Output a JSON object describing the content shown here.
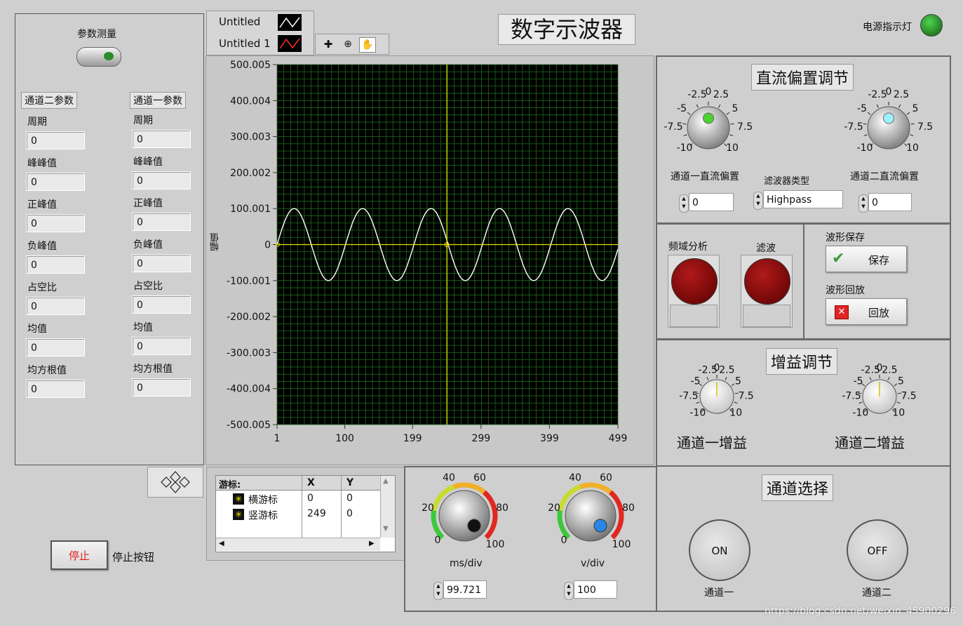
{
  "title": "数字示波器",
  "power": {
    "label": "电源指示灯",
    "color": "#1a7a1a"
  },
  "param_measure": {
    "label": "参数测量"
  },
  "channel2_params": {
    "header": "通道二参数",
    "items": [
      {
        "label": "周期",
        "value": "0"
      },
      {
        "label": "峰峰值",
        "value": "0"
      },
      {
        "label": "正峰值",
        "value": "0"
      },
      {
        "label": "负峰值",
        "value": "0"
      },
      {
        "label": "占空比",
        "value": "0"
      },
      {
        "label": "均值",
        "value": "0"
      },
      {
        "label": "均方根值",
        "value": "0"
      }
    ]
  },
  "channel1_params": {
    "header": "通道一参数",
    "items": [
      {
        "label": "周期",
        "value": "0"
      },
      {
        "label": "峰峰值",
        "value": "0"
      },
      {
        "label": "正峰值",
        "value": "0"
      },
      {
        "label": "负峰值",
        "value": "0"
      },
      {
        "label": "占空比",
        "value": "0"
      },
      {
        "label": "均值",
        "value": "0"
      },
      {
        "label": "均方根值",
        "value": "0"
      }
    ]
  },
  "legend": [
    {
      "name": "Untitled",
      "color": "#ffffff"
    },
    {
      "name": "Untitled 1",
      "color": "#ff2a2a"
    }
  ],
  "graph": {
    "ylabel": "幅值",
    "background": "#000000",
    "grid_color": "#1e6b1e",
    "trace_color": "#ffffff",
    "cursor_color": "#e8e000"
  },
  "chart_data": {
    "type": "line",
    "title": "",
    "xlabel": "",
    "ylabel": "幅值",
    "xlim": [
      1,
      499
    ],
    "ylim": [
      -500.005,
      500.005
    ],
    "x_ticks": [
      "1",
      "100",
      "199",
      "299",
      "399",
      "499"
    ],
    "y_ticks": [
      "500.005",
      "400.004",
      "300.003",
      "200.002",
      "100.001",
      "0",
      "-100.001",
      "-200.002",
      "-300.003",
      "-400.004",
      "-500.005"
    ],
    "series": [
      {
        "amplitude": 100.001,
        "period": 100,
        "phase_start_x": 1,
        "points": 499
      }
    ],
    "cursors": {
      "horizontal_y": 0,
      "vertical_x": 249
    }
  },
  "cursor_table": {
    "title": "游标:",
    "col_x": "X",
    "col_y": "Y",
    "rows": [
      {
        "name": "横游标",
        "x": "0",
        "y": "0"
      },
      {
        "name": "竖游标",
        "x": "249",
        "y": "0"
      }
    ]
  },
  "stop": {
    "button": "停止",
    "label": "停止按钮"
  },
  "dc_offset": {
    "header": "直流偏置调节",
    "knob_ticks": [
      "-2.5",
      "0",
      "2.5",
      "-5",
      "5",
      "-7.5",
      "7.5",
      "-10",
      "10"
    ],
    "ch1": {
      "label": "通道一直流偏置",
      "value": "0",
      "indicator": "#4cd130"
    },
    "ch2": {
      "label": "通道二直流偏置",
      "value": "0",
      "indicator": "#9ef0ff"
    },
    "filter_label": "滤波器类型",
    "filter_value": "Highpass"
  },
  "analysis": {
    "fft_label": "频域分析",
    "filter_label": "滤波",
    "save_label": "波形保存",
    "save_button": "保存",
    "replay_label": "波形回放",
    "replay_button": "回放"
  },
  "gain": {
    "header": "增益调节",
    "knob_ticks": [
      "-2.5",
      "0",
      "2.5",
      "-5",
      "5",
      "-7.5",
      "7.5",
      "-10",
      "10"
    ],
    "ch1_label": "通道一增益",
    "ch2_label": "通道二增益"
  },
  "timebase": {
    "ticks": [
      "40",
      "60",
      "20",
      "80",
      "0",
      "100"
    ],
    "ms_label": "ms/div",
    "ms_value": "99.721",
    "v_label": "v/div",
    "v_value": "100"
  },
  "channel_select": {
    "header": "通道选择",
    "on_label": "ON",
    "off_label": "OFF",
    "ch1_label": "通道一",
    "ch2_label": "通道二"
  },
  "watermark": "https://blog.csdn.net/weixin_45900296"
}
